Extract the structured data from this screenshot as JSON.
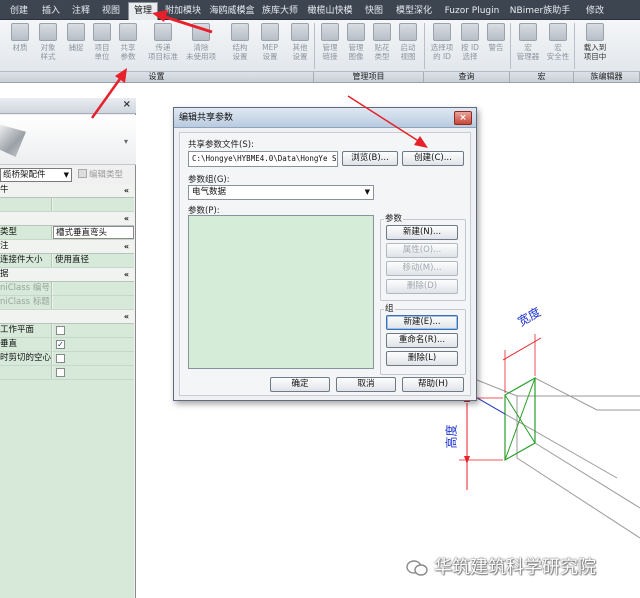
{
  "tabs": [
    "创建",
    "插入",
    "注释",
    "视图",
    "管理",
    "附加模块",
    "海鸥威模盒",
    "族库大师",
    "橄榄山快模",
    "快图",
    "模型深化",
    "Fuzor Plugin",
    "NBimer族助手",
    "修改"
  ],
  "active_tab": "管理",
  "ribbon": {
    "settings_buttons": [
      {
        "label": "材质"
      },
      {
        "label": "对象\n样式"
      },
      {
        "label": "捕捉"
      },
      {
        "label": "项目\n单位"
      },
      {
        "label": "共享\n参数"
      },
      {
        "label": "传递\n项目标准"
      },
      {
        "label": "清除\n未使用项"
      },
      {
        "label": "结构\n设置"
      },
      {
        "label": "MEP\n设置"
      },
      {
        "label": "其他\n设置"
      }
    ],
    "project_buttons": [
      {
        "label": "管理\n链接"
      },
      {
        "label": "管理\n图像"
      },
      {
        "label": "贴花\n类型"
      },
      {
        "label": "启动\n视图"
      }
    ],
    "inquiry_buttons": [
      {
        "label": "选择项\n的 ID"
      },
      {
        "label": "按 ID\n选择"
      },
      {
        "label": "警告"
      }
    ],
    "macro_buttons": [
      {
        "label": "宏\n管理器"
      },
      {
        "label": "宏\n安全性"
      }
    ],
    "family_editor_buttons": [
      {
        "label": "载入到\n项目中"
      }
    ],
    "panels": {
      "settings": "设置",
      "project": "管理项目",
      "inquiry": "查询",
      "macro": "宏",
      "family_editor": "族编辑器"
    }
  },
  "palette": {
    "close": "×",
    "type_selector": "缆桥架配件",
    "edit_type": "编辑类型",
    "rows": [
      {
        "kind": "group",
        "name": "牛"
      },
      {
        "kind": "prop",
        "name": "",
        "value": ""
      },
      {
        "kind": "group",
        "name": ""
      },
      {
        "kind": "prop",
        "name": "类型",
        "value": "槽式垂直弯头",
        "white": true
      },
      {
        "kind": "group",
        "name": "注"
      },
      {
        "kind": "prop",
        "name": "连接件大小",
        "value": "使用直径"
      },
      {
        "kind": "group",
        "name": "据"
      },
      {
        "kind": "prop",
        "name": "niClass 编号",
        "value": "",
        "dim": true
      },
      {
        "kind": "prop",
        "name": "niClass 标题",
        "value": "",
        "dim": true
      },
      {
        "kind": "group",
        "name": ""
      },
      {
        "kind": "check",
        "name": "工作平面",
        "checked": false
      },
      {
        "kind": "check",
        "name": "垂直",
        "checked": true
      },
      {
        "kind": "check",
        "name": "时剪切的空心",
        "checked": false
      },
      {
        "kind": "check",
        "name": "",
        "checked": false
      }
    ],
    "collapse_glyph": "«"
  },
  "dialog": {
    "title": "编辑共享参数",
    "close": "×",
    "file_label": "共享参数文件(S):",
    "file_path": "C:\\Hongye\\HYBME4.0\\Data\\HongYe Sh",
    "browse": "浏览(B)...",
    "create": "创建(C)...",
    "group_label": "参数组(G):",
    "group_value": "电气数据",
    "params_label": "参数(P):",
    "param_section": "参数",
    "param_new": "新建(N)...",
    "param_props": "属性(O)...",
    "param_move": "移动(M)...",
    "param_delete": "删除(D)",
    "group_section": "组",
    "group_new": "新建(E)...",
    "group_rename": "重命名(R)...",
    "group_delete": "删除(L)",
    "ok": "确定",
    "cancel": "取消",
    "help": "帮助(H)"
  },
  "drawing": {
    "width_label": "宽度",
    "height_label": "高度"
  },
  "watermark": "华筑建筑科学研究院",
  "colors": {
    "arrow": "#e8202a",
    "dimension": "#e8202a",
    "label": "#1a2fd0",
    "fitting": "#2aa02a",
    "palette_green": "#d7ead9",
    "tabbar": "#3d4551"
  }
}
